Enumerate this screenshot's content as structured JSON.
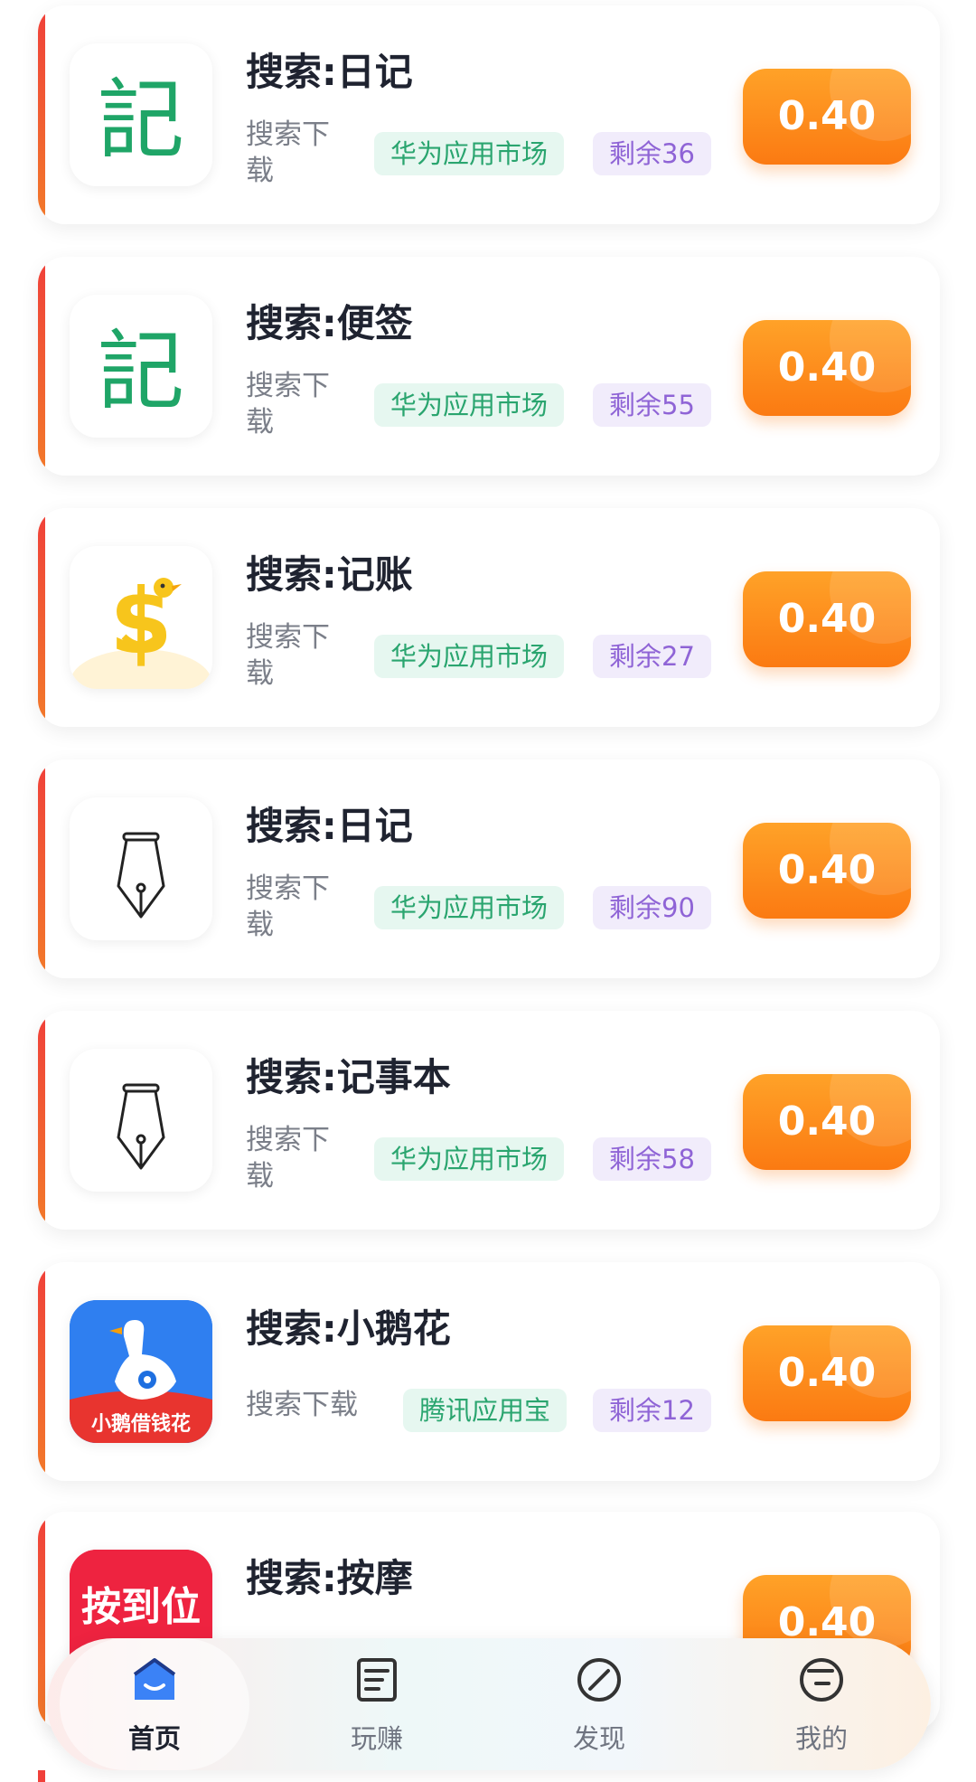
{
  "tasks": [
    {
      "title": "搜索:日记",
      "action": "搜索下载",
      "market": "华为应用市场",
      "remaining": "剩余36",
      "reward": "0.40",
      "icon": "ji-character-icon",
      "icon_text": "記"
    },
    {
      "title": "搜索:便签",
      "action": "搜索下载",
      "market": "华为应用市场",
      "remaining": "剩余55",
      "reward": "0.40",
      "icon": "ji-character-icon",
      "icon_text": "記"
    },
    {
      "title": "搜索:记账",
      "action": "搜索下载",
      "market": "华为应用市场",
      "remaining": "剩余27",
      "reward": "0.40",
      "icon": "dollar-duck-icon"
    },
    {
      "title": "搜索:日记",
      "action": "搜索下载",
      "market": "华为应用市场",
      "remaining": "剩余90",
      "reward": "0.40",
      "icon": "fountain-pen-icon"
    },
    {
      "title": "搜索:记事本",
      "action": "搜索下载",
      "market": "华为应用市场",
      "remaining": "剩余58",
      "reward": "0.40",
      "icon": "fountain-pen-icon"
    },
    {
      "title": "搜索:小鹅花",
      "action": "搜索下载",
      "market": "腾讯应用宝",
      "remaining": "剩余12",
      "reward": "0.40",
      "icon": "goose-app-icon",
      "icon_text": "小鹅借钱花"
    },
    {
      "title": "搜索:按摩",
      "reward": "0.40",
      "icon": "massage-app-icon",
      "icon_text": "按到位"
    }
  ],
  "nav": [
    {
      "label": "首页",
      "icon": "home-icon",
      "active": true
    },
    {
      "label": "玩赚",
      "icon": "task-list-icon",
      "active": false
    },
    {
      "label": "发现",
      "icon": "compass-icon",
      "active": false
    },
    {
      "label": "我的",
      "icon": "profile-icon",
      "active": false
    }
  ],
  "colors": {
    "accent_red": "#f0403a",
    "reward_orange": "#fb7a12",
    "market_green": "#2aa56f",
    "remain_purple": "#8f64d6",
    "title_dark": "#1f2330"
  }
}
